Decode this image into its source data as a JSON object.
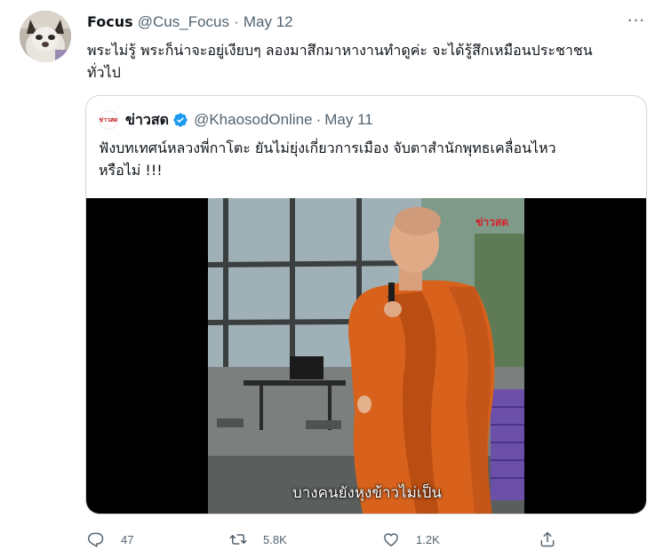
{
  "tweet": {
    "author_name": "Focus",
    "author_handle": "@Cus_Focus",
    "separator": "·",
    "date": "May 12",
    "more_label": "···",
    "text_line1": "พระไม่รู้ พระก็น่าจะอยู่เงียบๆ ลองมาสึกมาหางานทำดูค่ะ จะได้รู้สึกเหมือนประชาชน",
    "text_line2": "ทั่วไป"
  },
  "quoted_tweet": {
    "logo_text": "ข่าวสด",
    "author_name": "ข่าวสด",
    "author_handle": "@KhaosodOnline",
    "separator": "·",
    "date": "May 11",
    "text_line1": "ฟังบทเทศน์หลวงพี่กาโตะ ยันไม่ยุ่งเกี่ยวการเมือง จับตาสำนักพุทธเคลื่อนไหว",
    "text_line2": "หรือไม่ !!!",
    "video": {
      "watermark": "ข่าวสด",
      "subtitle": "บางคนยังหุงข้าวไม่เป็น"
    }
  },
  "actions": {
    "reply_count": "47",
    "retweet_count": "5.8K",
    "like_count": "1.2K",
    "reply_icon": "reply-icon",
    "retweet_icon": "retweet-icon",
    "like_icon": "heart-icon",
    "share_icon": "share-icon"
  },
  "colors": {
    "secondary_text": "#536471",
    "verified_blue": "#1d9bf0",
    "robe_orange": "#d8621c",
    "border": "#cfd9de"
  }
}
